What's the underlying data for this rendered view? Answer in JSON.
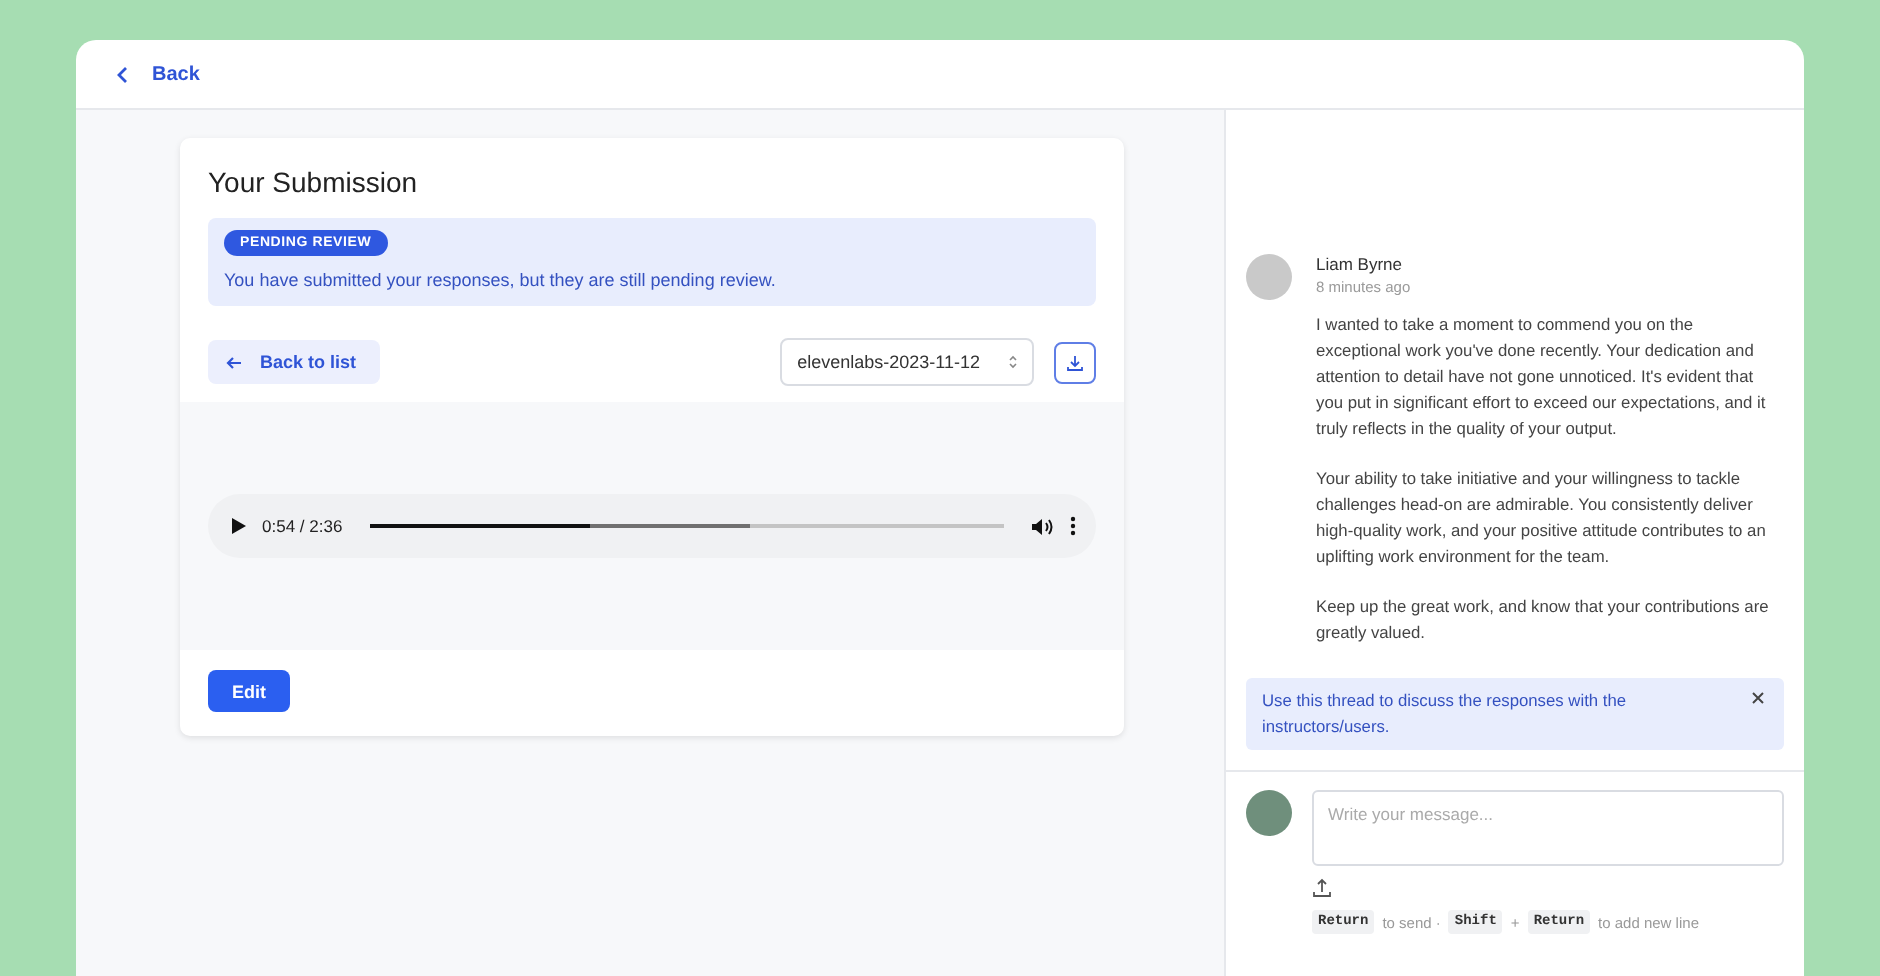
{
  "header": {
    "back_label": "Back"
  },
  "submission": {
    "title": "Your Submission",
    "status_badge": "PENDING REVIEW",
    "status_message": "You have submitted your responses, but they are still pending review.",
    "back_to_list": "Back to list",
    "file_select": "elevenlabs-2023-11-12",
    "audio": {
      "time": "0:54 / 2:36",
      "level": 0.346,
      "buffer": {
        "level": 0.6
      }
    },
    "edit_button": "Edit"
  },
  "thread": {
    "comment": {
      "author": "Liam Byrne",
      "time": "8 minutes ago",
      "paragraphs": [
        "I wanted to take a moment to commend you on the exceptional work you've done recently. Your dedication and attention to detail have not gone unnoticed. It's evident that you put in significant effort to exceed our expectations, and it truly reflects in the quality of your output.",
        "Your ability to take initiative and your willingness to tackle challenges head-on are admirable. You consistently deliver high-quality work, and your positive attitude contributes to an uplifting work environment for the team.",
        "Keep up the great work, and know that your contributions are greatly valued."
      ]
    },
    "notice": "Use this thread to discuss the responses with the instructors/users.",
    "composer": {
      "placeholder": "Write your message..."
    },
    "hint": [
      {
        "kind": "key",
        "text": "Return"
      },
      {
        "kind": "text",
        "text": "to send ·"
      },
      {
        "kind": "key",
        "text": "Shift"
      },
      {
        "kind": "text",
        "text": "+"
      },
      {
        "kind": "key",
        "text": "Return"
      },
      {
        "kind": "text",
        "text": "to add new line"
      }
    ]
  }
}
